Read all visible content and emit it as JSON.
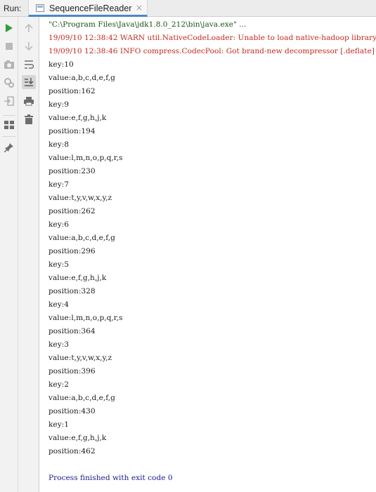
{
  "header": {
    "run_label": "Run:",
    "tab_title": "SequenceFileReader",
    "tab_close": "×"
  },
  "icons": {
    "left": [
      "run-icon",
      "stop-icon",
      "camera-icon",
      "settings-icon",
      "login-icon",
      "layout-icon",
      "pin-icon"
    ],
    "right": [
      "arrow-up-icon",
      "arrow-down-icon",
      "soft-wrap-icon",
      "scroll-to-end-icon",
      "print-icon",
      "trash-icon"
    ]
  },
  "colors": {
    "command": "#175415",
    "log": "#c42a1f",
    "output": "#1c1c1c",
    "finish": "#1a1a8a",
    "run_green": "#2e9f3d"
  },
  "console": {
    "command": "\"C:\\Program Files\\Java\\jdk1.8.0_212\\bin\\java.exe\" ...",
    "log_lines": [
      "19/09/10 12:38:42 WARN util.NativeCodeLoader: Unable to load native-hadoop library",
      "19/09/10 12:38:46 INFO compress.CodecPool: Got brand-new decompressor [.deflate]"
    ],
    "output_lines": [
      "key:10",
      "value:a,b,c,d,e,f,g",
      "position:162",
      "key:9",
      "value:e,f,g,h,j,k",
      "position:194",
      "key:8",
      "value:l,m,n,o,p,q,r,s",
      "position:230",
      "key:7",
      "value:t,y,v,w,x,y,z",
      "position:262",
      "key:6",
      "value:a,b,c,d,e,f,g",
      "position:296",
      "key:5",
      "value:e,f,g,h,j,k",
      "position:328",
      "key:4",
      "value:l,m,n,o,p,q,r,s",
      "position:364",
      "key:3",
      "value:t,y,v,w,x,y,z",
      "position:396",
      "key:2",
      "value:a,b,c,d,e,f,g",
      "position:430",
      "key:1",
      "value:e,f,g,h,j,k",
      "position:462"
    ],
    "finish": "Process finished with exit code 0"
  }
}
